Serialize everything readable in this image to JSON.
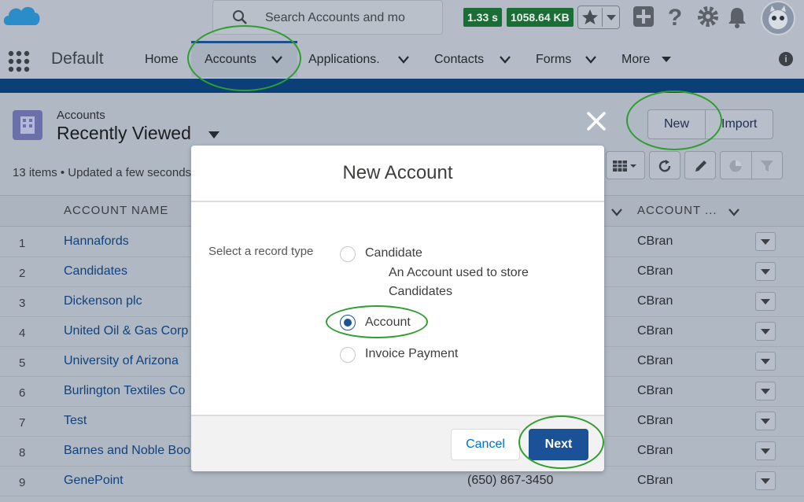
{
  "header": {
    "search_placeholder": "Search Accounts and mo",
    "badge_time": "1.33 s",
    "badge_size": "1058.64 KB",
    "icons": [
      "salesforce-cloud-logo",
      "search-icon",
      "star-icon",
      "chevron-down-icon",
      "plus-icon",
      "help-icon",
      "gear-icon",
      "bell-icon",
      "avatar"
    ]
  },
  "nav": {
    "app_name": "Default",
    "items": [
      {
        "label": "Home"
      },
      {
        "label": "Accounts"
      },
      {
        "label": "Applications."
      },
      {
        "label": "Contacts"
      },
      {
        "label": "Forms"
      },
      {
        "label": "More"
      }
    ],
    "info_icon": "i"
  },
  "list_view": {
    "object_label": "Accounts",
    "title": "Recently Viewed",
    "status": "13 items • Updated a few seconds ago",
    "buttons": {
      "new": "New",
      "import": "Import"
    },
    "columns": {
      "account_name": "ACCOUNT NAME",
      "owner": "ACCOUNT ..."
    },
    "rows": [
      {
        "num": "1",
        "name": "Hannafords",
        "phone": "",
        "owner": "CBran"
      },
      {
        "num": "2",
        "name": "Candidates",
        "phone": "",
        "owner": "CBran"
      },
      {
        "num": "3",
        "name": "Dickenson plc",
        "phone": "",
        "owner": "CBran"
      },
      {
        "num": "4",
        "name": "United Oil & Gas Corp",
        "phone": "",
        "owner": "CBran"
      },
      {
        "num": "5",
        "name": "University of Arizona",
        "phone": "",
        "owner": "CBran"
      },
      {
        "num": "6",
        "name": "Burlington Textiles Co",
        "phone": "",
        "owner": "CBran"
      },
      {
        "num": "7",
        "name": "Test",
        "phone": "",
        "owner": "CBran"
      },
      {
        "num": "8",
        "name": "Barnes and Noble Boo",
        "phone": "",
        "owner": "CBran"
      },
      {
        "num": "9",
        "name": "GenePoint",
        "phone": "(650) 867-3450",
        "owner": "CBran"
      }
    ]
  },
  "modal": {
    "title": "New Account",
    "field_label": "Select a record type",
    "options": [
      {
        "label": "Candidate",
        "description": "An Account used to store Candidates",
        "selected": false
      },
      {
        "label": "Account",
        "selected": true
      },
      {
        "label": "Invoice Payment",
        "selected": false
      }
    ],
    "cancel_label": "Cancel",
    "next_label": "Next"
  },
  "colors": {
    "brand_blue": "#1b5297",
    "link": "#0070d2",
    "annotation_green": "#2f9e2f"
  }
}
